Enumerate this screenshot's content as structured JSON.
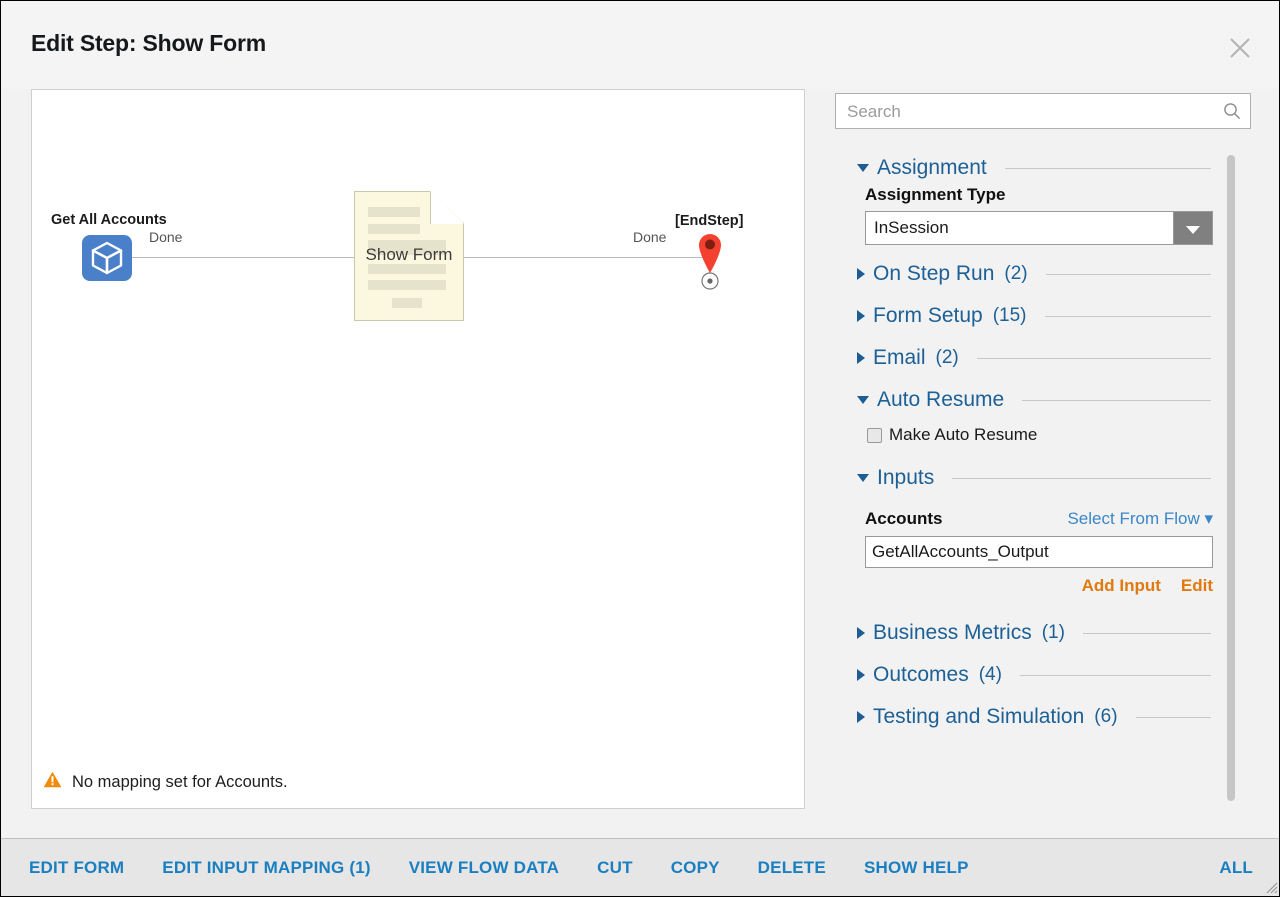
{
  "dialog": {
    "title": "Edit Step: Show Form",
    "close_icon": "close-icon"
  },
  "canvas": {
    "nodes": [
      {
        "id": "get-all-accounts",
        "label": "Get All Accounts",
        "icon": "cube-icon",
        "icon_color": "#4a7fc9"
      },
      {
        "id": "show-form",
        "label": "Show Form",
        "icon": "form-page-icon",
        "fill_color": "#fcf8e0"
      },
      {
        "id": "end-step",
        "label": "[EndStep]",
        "icon": "map-pin-icon",
        "pin_color": "#f4402f"
      }
    ],
    "connectors": [
      {
        "id": "connector-1",
        "label": "Done"
      },
      {
        "id": "connector-2",
        "label": "Done"
      }
    ],
    "warning": {
      "icon": "warning-triangle-icon",
      "color": "#f28b0c",
      "text": "No mapping set for Accounts."
    }
  },
  "search": {
    "placeholder": "Search",
    "value": "",
    "icon": "search-icon"
  },
  "panel": {
    "sections": [
      {
        "key": "assignment",
        "label": "Assignment",
        "count": "",
        "expanded": true
      },
      {
        "key": "on_step_run",
        "label": "On Step Run",
        "count": "(2)",
        "expanded": false
      },
      {
        "key": "form_setup",
        "label": "Form Setup",
        "count": "(15)",
        "expanded": false
      },
      {
        "key": "email",
        "label": "Email",
        "count": "(2)",
        "expanded": false
      },
      {
        "key": "auto_resume",
        "label": "Auto Resume",
        "count": "",
        "expanded": true
      },
      {
        "key": "inputs",
        "label": "Inputs",
        "count": "",
        "expanded": true
      },
      {
        "key": "business_metrics",
        "label": "Business Metrics",
        "count": "(1)",
        "expanded": false
      },
      {
        "key": "outcomes",
        "label": "Outcomes",
        "count": "(4)",
        "expanded": false
      },
      {
        "key": "testing_and_simulation",
        "label": "Testing and Simulation",
        "count": "(6)",
        "expanded": false
      }
    ],
    "assignment": {
      "type_label": "Assignment Type",
      "type_value": "InSession",
      "dropdown_icon": "chevron-down-icon"
    },
    "auto_resume": {
      "checkbox_label": "Make Auto Resume",
      "checked": false
    },
    "inputs": {
      "field_label": "Accounts",
      "select_from_flow_label": "Select From Flow",
      "select_from_flow_icon": "chevron-down-icon",
      "value": "GetAllAccounts_Output",
      "add_input_label": "Add Input",
      "edit_label": "Edit"
    }
  },
  "toolbar": {
    "left_buttons": [
      "EDIT FORM",
      "EDIT INPUT MAPPING (1)",
      "VIEW FLOW DATA",
      "CUT",
      "COPY",
      "DELETE",
      "SHOW HELP"
    ],
    "right_buttons": [
      "ALL"
    ],
    "resize_grip_icon": "resize-grip-icon"
  },
  "colors": {
    "accent_blue": "#1d6096",
    "link_blue": "#1a7fc1",
    "orange": "#e07a10",
    "warning_orange": "#f28b0c",
    "pin_red": "#f4402f"
  }
}
